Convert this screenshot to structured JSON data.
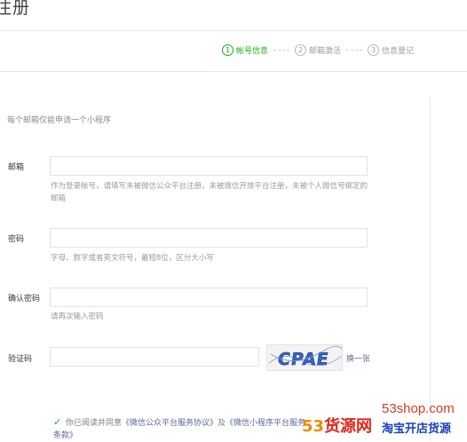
{
  "page": {
    "title": "注册"
  },
  "steps": [
    {
      "num": "1",
      "label": "帐号信息",
      "active": true
    },
    {
      "num": "2",
      "label": "邮箱激活",
      "active": false
    },
    {
      "num": "3",
      "label": "信息登记",
      "active": false
    }
  ],
  "intro": "每个邮箱仅能申请一个小程序",
  "form": {
    "email": {
      "label": "邮箱",
      "value": "",
      "hint": "作为登录帐号，请填写未被微信公众平台注册，未被微信开放平台注册，未被个人微信号绑定的邮箱"
    },
    "password": {
      "label": "密码",
      "value": "",
      "hint": "字母、数字或者英文符号，最短8位，区分大小写"
    },
    "confirm": {
      "label": "确认密码",
      "value": "",
      "hint": "请再次输入密码"
    },
    "captcha": {
      "label": "验证码",
      "value": "",
      "image_text": "CPAE",
      "refresh": "换一张"
    }
  },
  "agreement": {
    "prefix": "你已阅读并同意",
    "link1": "《微信公众平台服务协议》",
    "and": "及",
    "link2": "《微信小程序平台服务条款》"
  },
  "watermark": {
    "url": "53shop.com",
    "brand_num": "53",
    "brand_text": "货源网",
    "tagline": "淘宝开店货源"
  },
  "colors": {
    "accent": "#1aad19",
    "link": "#576b95",
    "watermark_red": "#e1261c",
    "watermark_blue": "#1b3fbf"
  }
}
